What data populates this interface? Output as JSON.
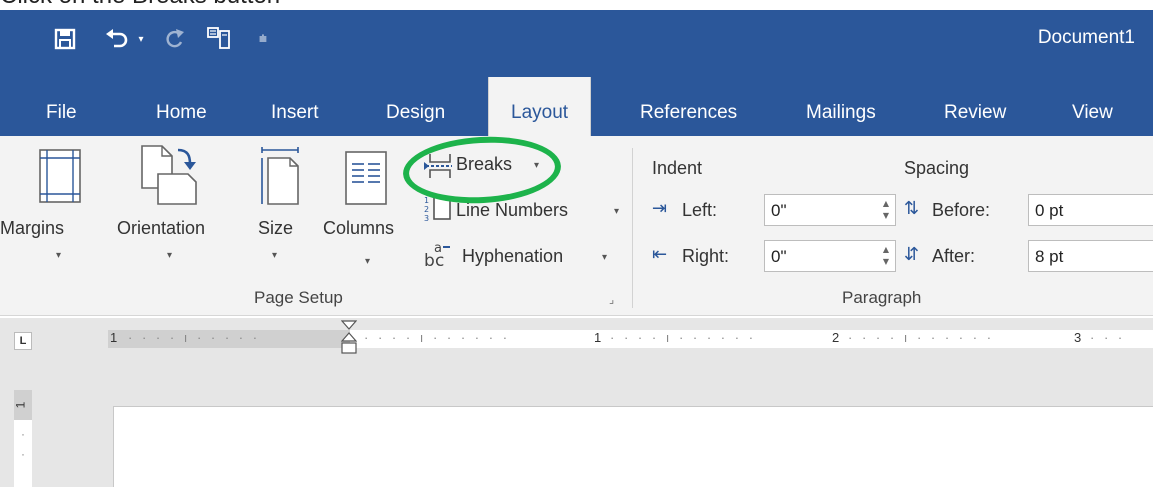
{
  "instruction": "Click on the Breaks button",
  "window": {
    "title": "Document1"
  },
  "quick_access": {
    "icons": [
      "save-icon",
      "undo-icon",
      "undo-dropdown-icon",
      "redo-icon",
      "touch-mode-icon",
      "customize-qat-icon"
    ]
  },
  "tabs": [
    {
      "label": "File",
      "active": false
    },
    {
      "label": "Home",
      "active": false
    },
    {
      "label": "Insert",
      "active": false
    },
    {
      "label": "Design",
      "active": false
    },
    {
      "label": "Layout",
      "active": true
    },
    {
      "label": "References",
      "active": false
    },
    {
      "label": "Mailings",
      "active": false
    },
    {
      "label": "Review",
      "active": false
    },
    {
      "label": "View",
      "active": false
    }
  ],
  "page_setup": {
    "group_label": "Page Setup",
    "margins": "Margins",
    "orientation": "Orientation",
    "size": "Size",
    "columns": "Columns",
    "breaks": "Breaks",
    "line_numbers": "Line Numbers",
    "hyphenation": "Hyphenation"
  },
  "paragraph": {
    "group_label": "Paragraph",
    "indent_label": "Indent",
    "spacing_label": "Spacing",
    "left_label": "Left:",
    "left_value": "0\"",
    "right_label": "Right:",
    "right_value": "0\"",
    "before_label": "Before:",
    "before_value": "0 pt",
    "after_label": "After:",
    "after_value": "8 pt"
  },
  "ruler": {
    "corner": "L",
    "numbers": [
      "1",
      "1",
      "2",
      "3"
    ],
    "vertical_number": "1"
  },
  "colors": {
    "brand": "#2b579a",
    "ribbon_bg": "#f3f3f3",
    "highlight": "#1db34b"
  }
}
